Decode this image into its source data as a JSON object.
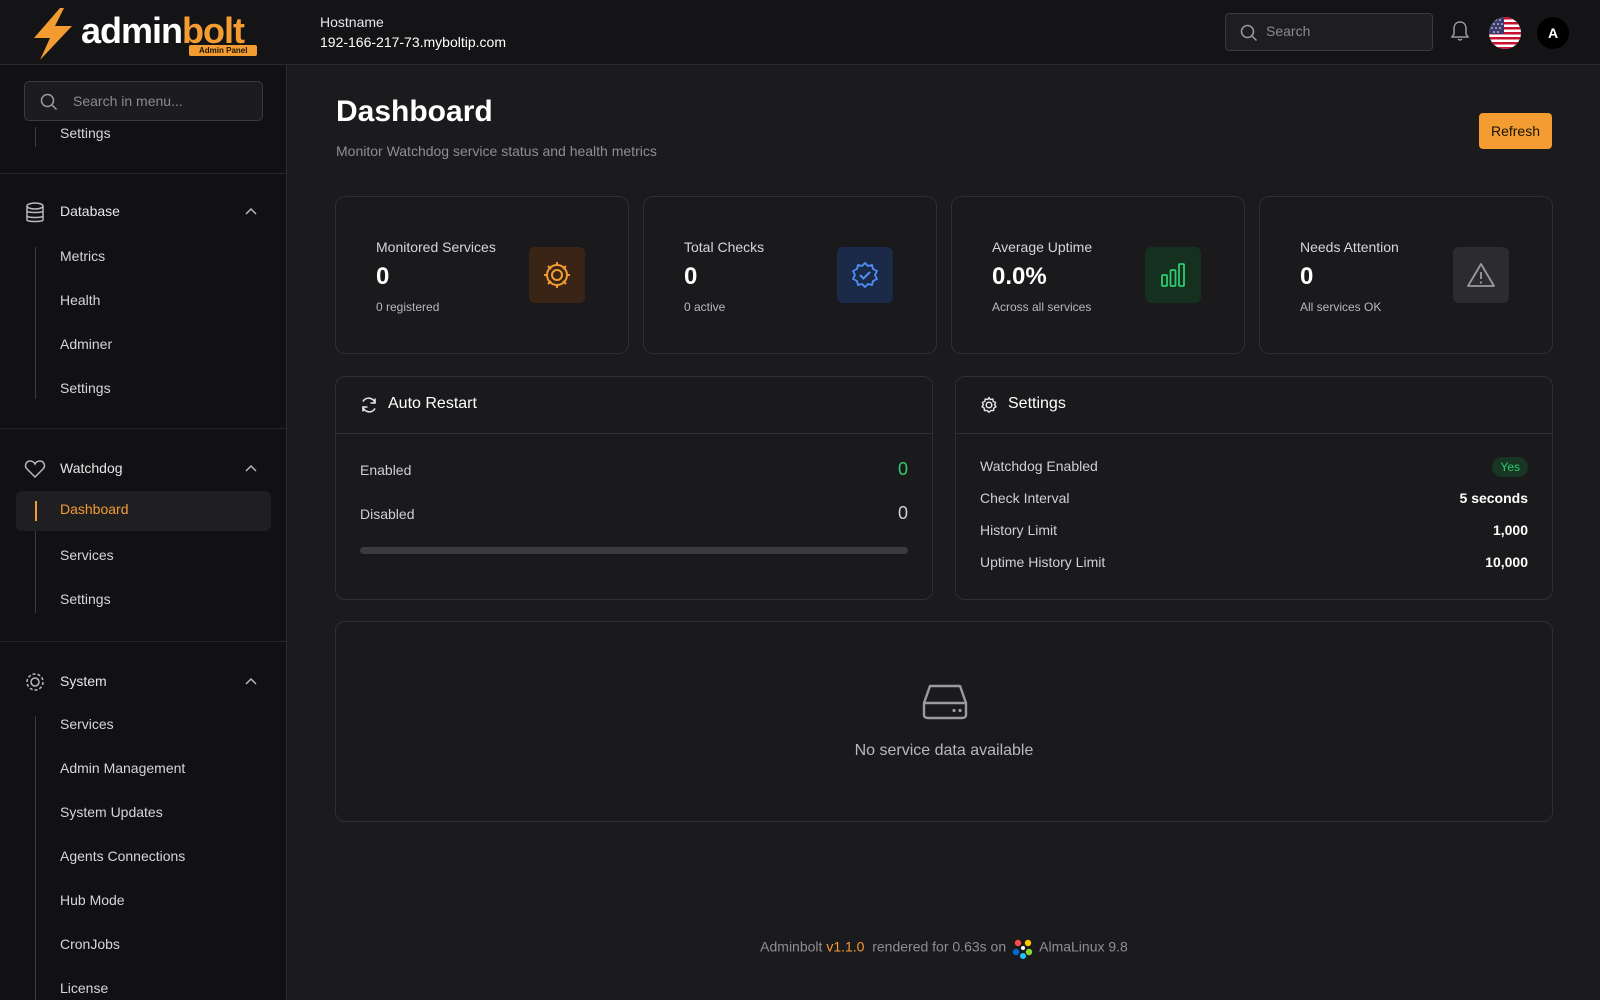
{
  "header": {
    "logo_primary": "admin",
    "logo_accent": "bolt",
    "logo_badge": "Admin Panel",
    "hostname_label": "Hostname",
    "hostname_value": "192-166-217-73.myboltip.com",
    "search_placeholder": "Search",
    "avatar_initial": "A",
    "language_flag": "us-flag-icon"
  },
  "sidebar": {
    "search_placeholder": "Search in menu...",
    "partial_item": "Settings",
    "groups": [
      {
        "label": "Database",
        "icon": "database-icon",
        "items": [
          "Metrics",
          "Health",
          "Adminer",
          "Settings"
        ]
      },
      {
        "label": "Watchdog",
        "icon": "heart-icon",
        "items": [
          "Dashboard",
          "Services",
          "Settings"
        ],
        "active": "Dashboard"
      },
      {
        "label": "System",
        "icon": "cog-icon",
        "items": [
          "Services",
          "Admin Management",
          "System Updates",
          "Agents Connections",
          "Hub Mode",
          "CronJobs",
          "License"
        ]
      }
    ]
  },
  "page": {
    "title": "Dashboard",
    "subtitle": "Monitor Watchdog service status and health metrics",
    "refresh_label": "Refresh"
  },
  "stats": [
    {
      "label": "Monitored Services",
      "value": "0",
      "sub": "0 registered",
      "icon": "gear-icon",
      "color": "#f39c32"
    },
    {
      "label": "Total Checks",
      "value": "0",
      "sub": "0 active",
      "icon": "badge-check-icon",
      "color": "#4f8ff7"
    },
    {
      "label": "Average Uptime",
      "value": "0.0%",
      "sub": "Across all services",
      "icon": "bar-chart-icon",
      "color": "#2ecc71"
    },
    {
      "label": "Needs Attention",
      "value": "0",
      "sub": "All services OK",
      "icon": "warning-icon",
      "color": "#9a9aa0"
    }
  ],
  "auto_restart": {
    "title": "Auto Restart",
    "enabled_label": "Enabled",
    "enabled_value": "0",
    "disabled_label": "Disabled",
    "disabled_value": "0",
    "progress": 0
  },
  "settings_panel": {
    "title": "Settings",
    "rows": [
      {
        "label": "Watchdog Enabled",
        "value": "Yes"
      },
      {
        "label": "Check Interval",
        "value": "5 seconds"
      },
      {
        "label": "History Limit",
        "value": "1,000"
      },
      {
        "label": "Uptime History Limit",
        "value": "10,000"
      }
    ]
  },
  "empty_state": {
    "message": "No service data available"
  },
  "footer": {
    "brand": "Adminbolt",
    "version": "v1.1.0",
    "rendered": "rendered for 0.63s on",
    "os": "AlmaLinux 9.8"
  },
  "colors": {
    "accent": "#f39c32",
    "success": "#2ecc71",
    "info": "#4f8ff7"
  }
}
